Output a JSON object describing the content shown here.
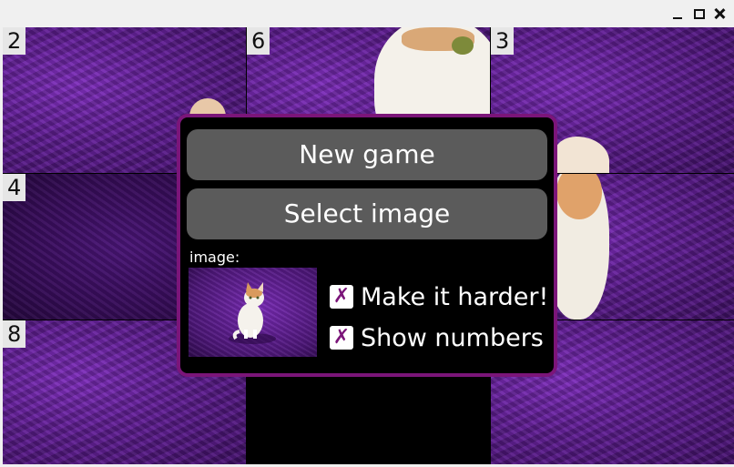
{
  "window": {
    "controls": [
      "minimize-icon",
      "maximize-icon",
      "close-icon"
    ]
  },
  "board": {
    "tiles": [
      {
        "number": "2"
      },
      {
        "number": "6"
      },
      {
        "number": "3"
      },
      {
        "number": "4"
      },
      {
        "number": ""
      },
      {
        "number": ""
      },
      {
        "number": "8"
      },
      {
        "number": ""
      }
    ]
  },
  "menu": {
    "new_game_label": "New game",
    "select_image_label": "Select image",
    "image_label": "image:",
    "options": [
      {
        "label": "Make it harder!",
        "checked": true,
        "mark": "✗"
      },
      {
        "label": "Show numbers",
        "checked": true,
        "mark": "✗"
      }
    ]
  },
  "colors": {
    "dialog_border": "#7b1579",
    "button_bg": "#5b5b5b",
    "checkmark": "#7b1579"
  }
}
